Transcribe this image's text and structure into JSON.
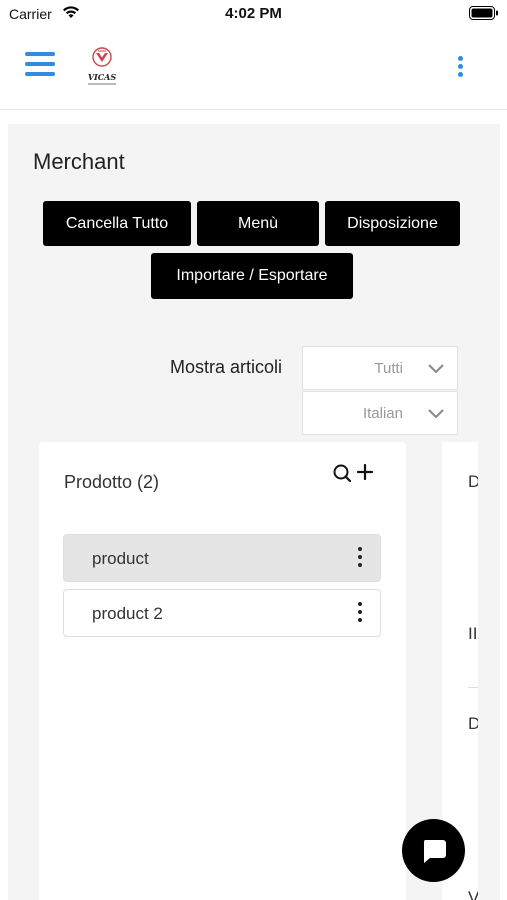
{
  "status_bar": {
    "carrier": "Carrier",
    "time": "4:02 PM",
    "icons": [
      "wifi-icon",
      "battery-icon"
    ]
  },
  "header": {
    "menu_icon": "hamburger-icon",
    "logo_text": "VICAS",
    "more_icon": "vertical-dots-icon",
    "accent_color": "#2f8be4"
  },
  "page": {
    "title": "Merchant"
  },
  "toolbar": {
    "clear_all_label": "Cancella Tutto",
    "menu_label": "Menù",
    "layout_label": "Disposizione",
    "import_export_label": "Importare / Esportare"
  },
  "filters": {
    "show_items_label": "Mostra articoli",
    "show_items_value": "Tutti",
    "language_value": "Italian"
  },
  "product_panel": {
    "title": "Prodotto (2)",
    "tools_icons": [
      "search-icon",
      "add-icon"
    ],
    "items": [
      {
        "label": "product",
        "selected": true
      },
      {
        "label": "product 2",
        "selected": false
      }
    ]
  },
  "second_panel": {
    "partial_texts": [
      "D",
      "II",
      "D",
      "V"
    ]
  },
  "chat": {
    "icon": "chat-bubble-icon"
  }
}
